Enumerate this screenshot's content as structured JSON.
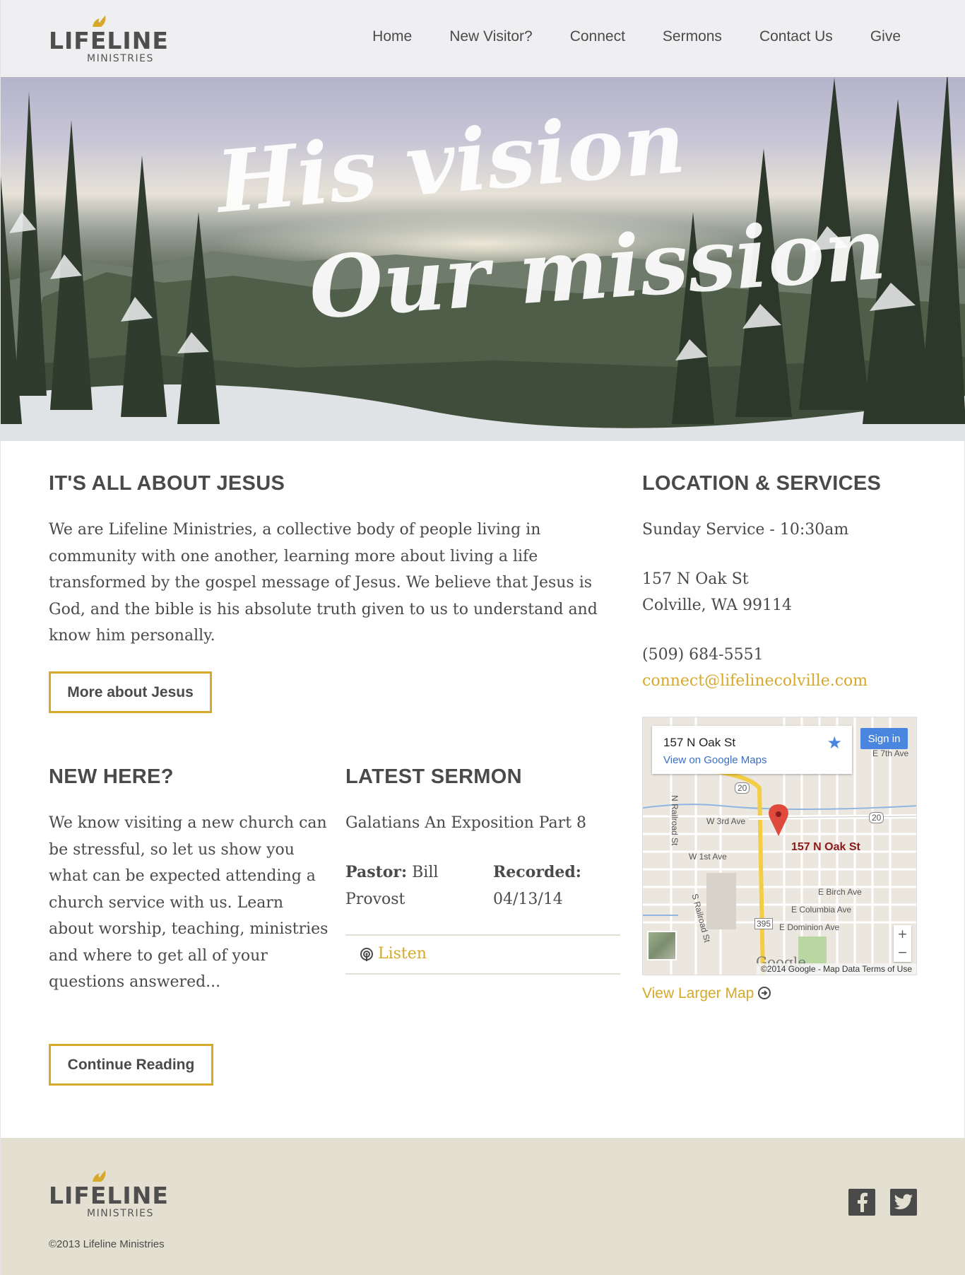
{
  "brand": {
    "name": "LIFELINE",
    "subtitle": "MINISTRIES"
  },
  "nav": [
    "Home",
    "New Visitor?",
    "Connect",
    "Sermons",
    "Contact Us",
    "Give"
  ],
  "hero": {
    "line1": "His vision",
    "line2": "Our mission"
  },
  "about": {
    "title_light": "IT'S ALL ABOUT ",
    "title_bold": "JESUS",
    "body": "We are Lifeline Ministries, a collective body of people living in community with one another, learning more about living a life transformed by the gospel message of Jesus. We believe that Jesus is God, and the bible is his absolute truth given to us to understand and know him personally.",
    "button": "More about Jesus"
  },
  "new_here": {
    "title_bold": "NEW",
    "title_light": " HERE?",
    "body": "We know visiting a new church can be stressful, so let us show you what can be expected attending a church service with us. Learn about worship, teaching, ministries and where to get all of your questions answered...",
    "button": "Continue Reading"
  },
  "sermon": {
    "title_light": "LATEST ",
    "title_bold": "SERMON",
    "name": "Galatians An Exposition Part 8",
    "pastor_label": "Pastor:",
    "pastor_value": " Bill Provost",
    "recorded_label": "Recorded:",
    "recorded_value": "04/13/14",
    "listen": "Listen"
  },
  "location": {
    "title_bold": "LOCATION",
    "title_light": " & SERVICES",
    "service": "Sunday Service - 10:30am",
    "street": "157 N Oak St",
    "city": "Colville, WA 99114",
    "phone": "(509) 684-5551",
    "email": "connect@lifelinecolville.com",
    "view_larger": "View Larger Map"
  },
  "map": {
    "address": "157 N Oak St",
    "view_on_maps": "View on Google Maps",
    "sign_in": "Sign in",
    "pin_label": "157 N Oak St",
    "zoom_in": "+",
    "zoom_out": "−",
    "google": "Google",
    "attribution": "©2014 Google - Map Data    Terms of Use",
    "streets": {
      "w3rd": "W 3rd Ave",
      "w1st": "W 1st Ave",
      "n_railroad": "N Railroad St",
      "s_railroad": "S Railroad St",
      "e_birch": "E Birch Ave",
      "e_columbia": "E Columbia Ave",
      "e_dominion": "E Dominion Ave",
      "e_7th": "E 7th Ave",
      "hwy20a": "20",
      "hwy20b": "20",
      "hwy395": "395"
    }
  },
  "footer": {
    "copyright": "©2013 Lifeline Ministries"
  },
  "colors": {
    "accent": "#d6a92a",
    "text": "#4a4a4a",
    "footer_bg": "#e3e0d1"
  },
  "icons": {
    "facebook": "facebook-icon",
    "twitter": "twitter-icon",
    "listen": "podcast-icon"
  }
}
